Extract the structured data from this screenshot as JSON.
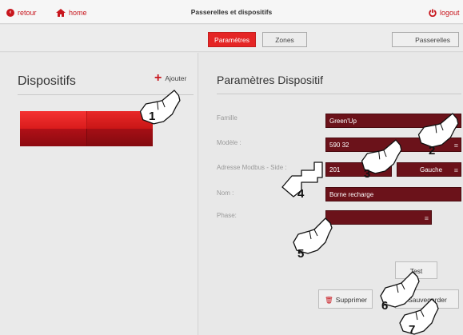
{
  "header": {
    "back_label": "retour",
    "home_label": "home",
    "title": "Passerelles et dispositifs",
    "logout_label": "logout"
  },
  "tabs": {
    "parametres": "Paramètres",
    "zones": "Zones",
    "passerelles": "Passerelles"
  },
  "left": {
    "title": "Dispositifs",
    "add_label": "Ajouter"
  },
  "right": {
    "title": "Paramètres Dispositif",
    "fields": {
      "famille_label": "Famille",
      "famille_value": "Green'Up",
      "modele_label": "Modèle :",
      "modele_value": "590 32",
      "adresse_label": "Adresse Modbus - Side :",
      "adresse_value": "201",
      "side_value": "Gauche",
      "nom_label": "Nom :",
      "nom_value": "Borne recharge",
      "phase_label": "Phase:",
      "phase_value": ""
    },
    "buttons": {
      "test": "Test",
      "supprimer": "Supprimer",
      "sauvegarder": "Sauvegarder"
    }
  },
  "callouts": [
    "1",
    "2",
    "3",
    "4",
    "5",
    "6",
    "7"
  ],
  "colors": {
    "accent": "#e52525",
    "field_bg": "#6b121a",
    "brand_red": "#c8161d"
  }
}
